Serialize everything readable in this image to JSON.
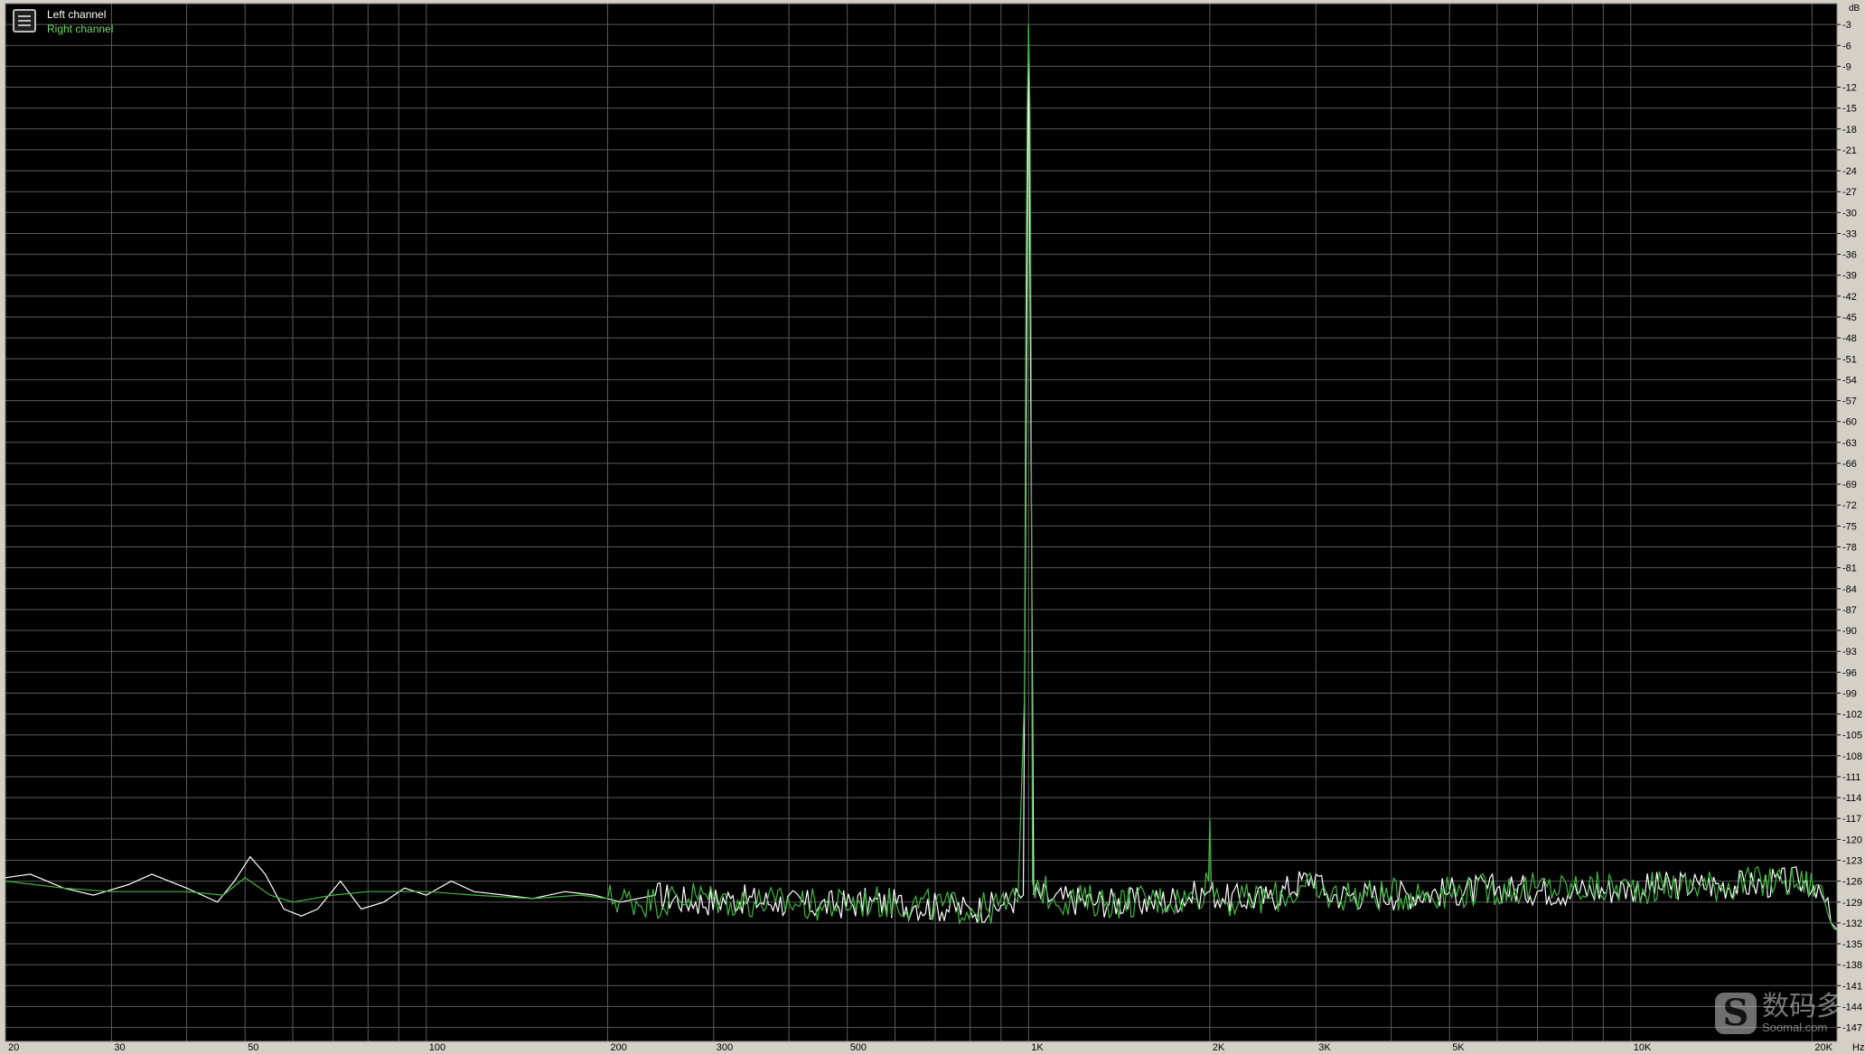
{
  "legend": {
    "left_label": "Left channel",
    "right_label": "Right channel"
  },
  "watermark": {
    "cn": "数码多",
    "en": "Soomal.com"
  },
  "colors": {
    "background": "#000000",
    "grid": "#5a5a5a",
    "frame": "#d4d0c8",
    "left_channel": "#ffffff",
    "right_channel": "#3fb83f"
  },
  "chart_data": {
    "type": "line",
    "x_scale": "log",
    "xlim": [
      20,
      22000
    ],
    "ylim": [
      -149,
      0
    ],
    "x_unit": "Hz",
    "y_unit": "dB",
    "x_ticks": [
      {
        "v": 20,
        "label": "20"
      },
      {
        "v": 30,
        "label": "30"
      },
      {
        "v": 50,
        "label": "50"
      },
      {
        "v": 100,
        "label": "100"
      },
      {
        "v": 200,
        "label": "200"
      },
      {
        "v": 300,
        "label": "300"
      },
      {
        "v": 500,
        "label": "500"
      },
      {
        "v": 1000,
        "label": "1K"
      },
      {
        "v": 2000,
        "label": "2K"
      },
      {
        "v": 3000,
        "label": "3K"
      },
      {
        "v": 5000,
        "label": "5K"
      },
      {
        "v": 10000,
        "label": "10K"
      },
      {
        "v": 20000,
        "label": "20K"
      }
    ],
    "x_grid": [
      20,
      30,
      40,
      50,
      60,
      70,
      80,
      90,
      100,
      200,
      300,
      400,
      500,
      600,
      700,
      800,
      900,
      1000,
      2000,
      3000,
      4000,
      5000,
      6000,
      7000,
      8000,
      9000,
      10000,
      20000
    ],
    "y_ticks": [
      -3,
      -6,
      -9,
      -12,
      -15,
      -18,
      -21,
      -24,
      -27,
      -30,
      -33,
      -36,
      -39,
      -42,
      -45,
      -48,
      -51,
      -54,
      -57,
      -60,
      -63,
      -66,
      -69,
      -72,
      -75,
      -78,
      -81,
      -84,
      -87,
      -90,
      -93,
      -96,
      -99,
      -102,
      -105,
      -108,
      -111,
      -114,
      -117,
      -120,
      -123,
      -126,
      -129,
      -132,
      -135,
      -138,
      -141,
      -144,
      -147
    ],
    "series": [
      {
        "name": "Left channel",
        "color": "#ffffff",
        "points": [
          [
            20,
            -125.5
          ],
          [
            22,
            -125
          ],
          [
            25,
            -127
          ],
          [
            28,
            -128
          ],
          [
            32,
            -126.5
          ],
          [
            35,
            -125
          ],
          [
            40,
            -127
          ],
          [
            45,
            -129
          ],
          [
            48,
            -126
          ],
          [
            51,
            -122.5
          ],
          [
            54,
            -125
          ],
          [
            58,
            -130
          ],
          [
            62,
            -131
          ],
          [
            66,
            -130
          ],
          [
            72,
            -126
          ],
          [
            78,
            -130
          ],
          [
            85,
            -129
          ],
          [
            92,
            -127
          ],
          [
            100,
            -128
          ],
          [
            110,
            -126
          ],
          [
            120,
            -127.5
          ],
          [
            135,
            -128
          ],
          [
            150,
            -128.5
          ],
          [
            170,
            -127.5
          ],
          [
            190,
            -128
          ],
          [
            210,
            -129
          ],
          [
            240,
            -128
          ],
          [
            280,
            -129
          ],
          [
            320,
            -128.5
          ],
          [
            380,
            -129
          ],
          [
            450,
            -129.5
          ],
          [
            550,
            -129
          ],
          [
            650,
            -129.5
          ],
          [
            800,
            -130
          ],
          [
            900,
            -129.5
          ],
          [
            980,
            -128
          ],
          [
            1000,
            -3.5
          ],
          [
            1020,
            -128
          ],
          [
            1100,
            -128.5
          ],
          [
            1300,
            -129
          ],
          [
            1600,
            -129
          ],
          [
            1900,
            -128
          ],
          [
            2000,
            -127.5
          ],
          [
            2100,
            -128.5
          ],
          [
            2500,
            -128.5
          ],
          [
            3000,
            -125
          ],
          [
            3100,
            -128
          ],
          [
            4000,
            -128
          ],
          [
            5000,
            -127.5
          ],
          [
            6000,
            -127
          ],
          [
            8000,
            -127.5
          ],
          [
            10000,
            -127
          ],
          [
            13000,
            -126.5
          ],
          [
            16000,
            -126.5
          ],
          [
            19000,
            -126
          ],
          [
            20500,
            -126.5
          ],
          [
            21000,
            -129
          ],
          [
            21500,
            -132
          ],
          [
            22000,
            -133
          ]
        ]
      },
      {
        "name": "Right channel",
        "color": "#3fb83f",
        "points": [
          [
            20,
            -126
          ],
          [
            25,
            -127
          ],
          [
            30,
            -127.5
          ],
          [
            40,
            -127.5
          ],
          [
            46,
            -128
          ],
          [
            50,
            -125.5
          ],
          [
            55,
            -128
          ],
          [
            60,
            -129
          ],
          [
            70,
            -128
          ],
          [
            80,
            -127.5
          ],
          [
            100,
            -127.5
          ],
          [
            120,
            -128
          ],
          [
            150,
            -128.5
          ],
          [
            180,
            -128
          ],
          [
            200,
            -128.5
          ],
          [
            240,
            -129
          ],
          [
            280,
            -128
          ],
          [
            320,
            -129
          ],
          [
            380,
            -129
          ],
          [
            450,
            -129.5
          ],
          [
            550,
            -129
          ],
          [
            700,
            -129.5
          ],
          [
            850,
            -130
          ],
          [
            960,
            -129
          ],
          [
            985,
            -99
          ],
          [
            990,
            -40
          ],
          [
            995,
            -15
          ],
          [
            1000,
            -3
          ],
          [
            1005,
            -15
          ],
          [
            1010,
            -51
          ],
          [
            1015,
            -126
          ],
          [
            1100,
            -128.5
          ],
          [
            1400,
            -129
          ],
          [
            1900,
            -128.5
          ],
          [
            1990,
            -126
          ],
          [
            2000,
            -117
          ],
          [
            2010,
            -126
          ],
          [
            2100,
            -129
          ],
          [
            2500,
            -128.5
          ],
          [
            2990,
            -127
          ],
          [
            3000,
            -126
          ],
          [
            3010,
            -128
          ],
          [
            4000,
            -128
          ],
          [
            5000,
            -127.5
          ],
          [
            7000,
            -127
          ],
          [
            10000,
            -127
          ],
          [
            14000,
            -126.5
          ],
          [
            18000,
            -126
          ],
          [
            20500,
            -126.5
          ],
          [
            21000,
            -129
          ],
          [
            21500,
            -132
          ],
          [
            22000,
            -133
          ]
        ]
      }
    ]
  }
}
